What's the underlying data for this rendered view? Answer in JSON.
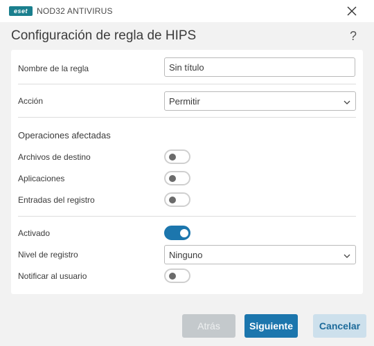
{
  "app": {
    "logo_text": "eset",
    "title": "NOD32 ANTIVIRUS"
  },
  "header": {
    "title": "Configuración de regla de HIPS",
    "help_label": "?"
  },
  "form": {
    "rule_name": {
      "label": "Nombre de la regla",
      "value": "Sin título"
    },
    "action": {
      "label": "Acción",
      "value": "Permitir"
    },
    "affected_title": "Operaciones afectadas",
    "target_files": {
      "label": "Archivos de destino",
      "enabled": false
    },
    "applications": {
      "label": "Aplicaciones",
      "enabled": false
    },
    "registry_entries": {
      "label": "Entradas del registro",
      "enabled": false
    },
    "activated": {
      "label": "Activado",
      "enabled": true
    },
    "log_level": {
      "label": "Nivel de registro",
      "value": "Ninguno"
    },
    "notify_user": {
      "label": "Notificar al usuario",
      "enabled": false
    }
  },
  "footer": {
    "back_label": "Atrás",
    "next_label": "Siguiente",
    "cancel_label": "Cancelar"
  },
  "colors": {
    "accent": "#1c76ad",
    "brand": "#1a7f8e"
  },
  "icons": {
    "close": "close-icon",
    "help": "help-icon",
    "dropdown": "chevron-down-icon"
  }
}
